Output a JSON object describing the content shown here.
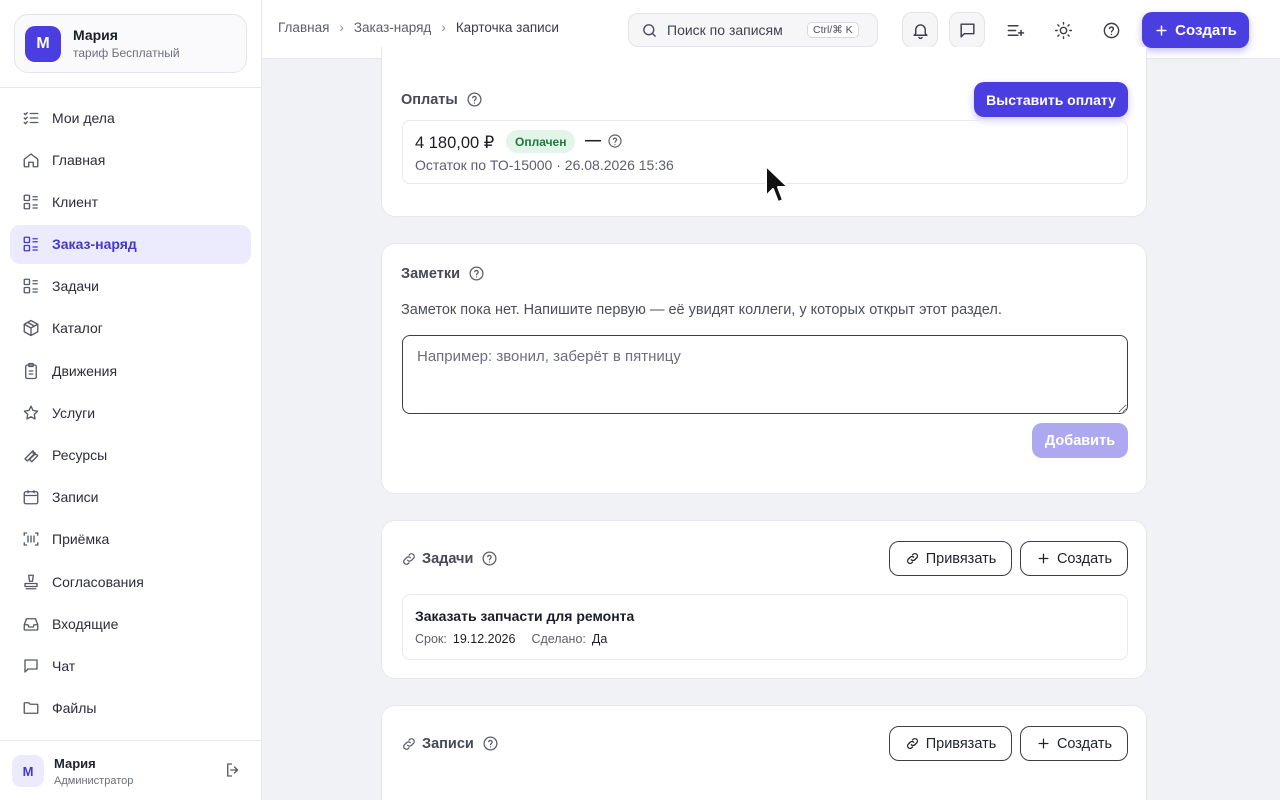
{
  "org": {
    "avatar": "M",
    "name": "Мария",
    "plan": "тариф Бесплатный"
  },
  "sidebar": {
    "items": [
      {
        "label": "Мои дела",
        "icon": "checklist-icon"
      },
      {
        "label": "Главная",
        "icon": "home-icon"
      },
      {
        "label": "Клиент",
        "icon": "list-icon"
      },
      {
        "label": "Заказ-наряд",
        "icon": "list-icon"
      },
      {
        "label": "Задачи",
        "icon": "list-icon"
      },
      {
        "label": "Каталог",
        "icon": "box-icon"
      },
      {
        "label": "Движения",
        "icon": "clipboard-icon"
      },
      {
        "label": "Услуги",
        "icon": "star-icon"
      },
      {
        "label": "Ресурсы",
        "icon": "wrench-icon"
      },
      {
        "label": "Записи",
        "icon": "calendar-icon"
      },
      {
        "label": "Приёмка",
        "icon": "scan-icon"
      },
      {
        "label": "Согласования",
        "icon": "stamp-icon"
      },
      {
        "label": "Входящие",
        "icon": "inbox-icon"
      },
      {
        "label": "Чат",
        "icon": "chat-icon"
      },
      {
        "label": "Файлы",
        "icon": "folder-icon"
      }
    ],
    "active_index": 3
  },
  "user": {
    "avatar": "M",
    "name": "Мария",
    "role": "Администратор"
  },
  "breadcrumb": {
    "home": "Главная",
    "section": "Заказ-наряд",
    "current": "Карточка записи"
  },
  "search": {
    "placeholder": "Поиск по записям",
    "shortcut": "Ctrl/⌘ K"
  },
  "toolbar": {
    "create_label": "Создать"
  },
  "payments": {
    "title": "Оплаты",
    "action_label": "Выставить оплату",
    "amount": "4 180,00 ₽",
    "status": "Оплачен",
    "dash": "—",
    "subtitle": "Остаток по ТО-15000 · 26.08.2026 15:36",
    "status_color": "#1f7a3a"
  },
  "notes": {
    "title": "Заметки",
    "empty_text": "Заметок пока нет. Напишите первую — её увидят коллеги, у которых открыт этот раздел.",
    "placeholder": "Например: звонил, заберёт в пятницу",
    "add_label": "Добавить"
  },
  "tasks": {
    "title": "Задачи",
    "bind_label": "Привязать",
    "create_label": "Создать",
    "items": [
      {
        "title": "Заказать запчасти для ремонта",
        "due_label": "Срок:",
        "due": "19.12.2026",
        "done_label": "Сделано:",
        "done": "Да"
      }
    ]
  },
  "records": {
    "title": "Записи",
    "bind_label": "Привязать",
    "create_label": "Создать"
  },
  "colors": {
    "accent": "#4a3ee0",
    "active_bg": "#ecebfd",
    "success_bg": "#e3f4e8"
  }
}
